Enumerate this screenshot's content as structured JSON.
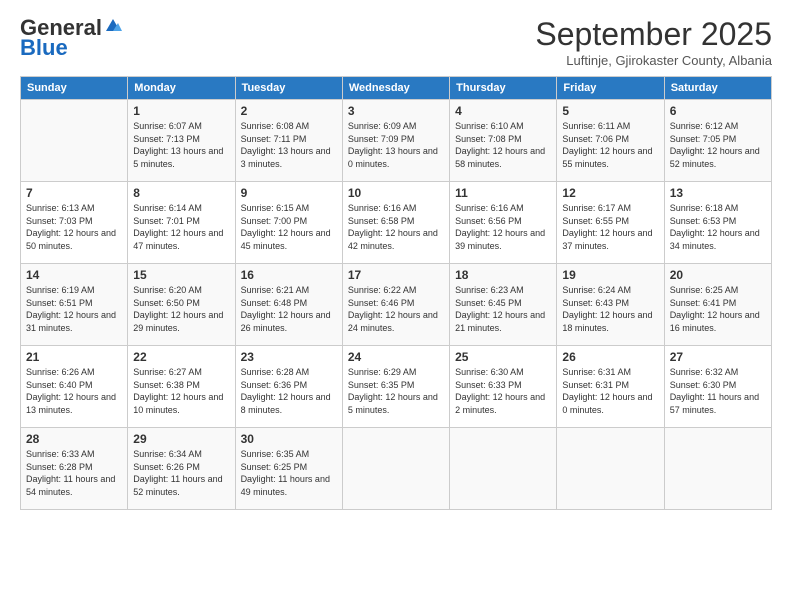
{
  "header": {
    "logo_line1": "General",
    "logo_line2": "Blue",
    "month_title": "September 2025",
    "location": "Luftinje, Gjirokaster County, Albania"
  },
  "days_of_week": [
    "Sunday",
    "Monday",
    "Tuesday",
    "Wednesday",
    "Thursday",
    "Friday",
    "Saturday"
  ],
  "weeks": [
    [
      {
        "day": "",
        "sunrise": "",
        "sunset": "",
        "daylight": ""
      },
      {
        "day": "1",
        "sunrise": "Sunrise: 6:07 AM",
        "sunset": "Sunset: 7:13 PM",
        "daylight": "Daylight: 13 hours and 5 minutes."
      },
      {
        "day": "2",
        "sunrise": "Sunrise: 6:08 AM",
        "sunset": "Sunset: 7:11 PM",
        "daylight": "Daylight: 13 hours and 3 minutes."
      },
      {
        "day": "3",
        "sunrise": "Sunrise: 6:09 AM",
        "sunset": "Sunset: 7:09 PM",
        "daylight": "Daylight: 13 hours and 0 minutes."
      },
      {
        "day": "4",
        "sunrise": "Sunrise: 6:10 AM",
        "sunset": "Sunset: 7:08 PM",
        "daylight": "Daylight: 12 hours and 58 minutes."
      },
      {
        "day": "5",
        "sunrise": "Sunrise: 6:11 AM",
        "sunset": "Sunset: 7:06 PM",
        "daylight": "Daylight: 12 hours and 55 minutes."
      },
      {
        "day": "6",
        "sunrise": "Sunrise: 6:12 AM",
        "sunset": "Sunset: 7:05 PM",
        "daylight": "Daylight: 12 hours and 52 minutes."
      }
    ],
    [
      {
        "day": "7",
        "sunrise": "Sunrise: 6:13 AM",
        "sunset": "Sunset: 7:03 PM",
        "daylight": "Daylight: 12 hours and 50 minutes."
      },
      {
        "day": "8",
        "sunrise": "Sunrise: 6:14 AM",
        "sunset": "Sunset: 7:01 PM",
        "daylight": "Daylight: 12 hours and 47 minutes."
      },
      {
        "day": "9",
        "sunrise": "Sunrise: 6:15 AM",
        "sunset": "Sunset: 7:00 PM",
        "daylight": "Daylight: 12 hours and 45 minutes."
      },
      {
        "day": "10",
        "sunrise": "Sunrise: 6:16 AM",
        "sunset": "Sunset: 6:58 PM",
        "daylight": "Daylight: 12 hours and 42 minutes."
      },
      {
        "day": "11",
        "sunrise": "Sunrise: 6:16 AM",
        "sunset": "Sunset: 6:56 PM",
        "daylight": "Daylight: 12 hours and 39 minutes."
      },
      {
        "day": "12",
        "sunrise": "Sunrise: 6:17 AM",
        "sunset": "Sunset: 6:55 PM",
        "daylight": "Daylight: 12 hours and 37 minutes."
      },
      {
        "day": "13",
        "sunrise": "Sunrise: 6:18 AM",
        "sunset": "Sunset: 6:53 PM",
        "daylight": "Daylight: 12 hours and 34 minutes."
      }
    ],
    [
      {
        "day": "14",
        "sunrise": "Sunrise: 6:19 AM",
        "sunset": "Sunset: 6:51 PM",
        "daylight": "Daylight: 12 hours and 31 minutes."
      },
      {
        "day": "15",
        "sunrise": "Sunrise: 6:20 AM",
        "sunset": "Sunset: 6:50 PM",
        "daylight": "Daylight: 12 hours and 29 minutes."
      },
      {
        "day": "16",
        "sunrise": "Sunrise: 6:21 AM",
        "sunset": "Sunset: 6:48 PM",
        "daylight": "Daylight: 12 hours and 26 minutes."
      },
      {
        "day": "17",
        "sunrise": "Sunrise: 6:22 AM",
        "sunset": "Sunset: 6:46 PM",
        "daylight": "Daylight: 12 hours and 24 minutes."
      },
      {
        "day": "18",
        "sunrise": "Sunrise: 6:23 AM",
        "sunset": "Sunset: 6:45 PM",
        "daylight": "Daylight: 12 hours and 21 minutes."
      },
      {
        "day": "19",
        "sunrise": "Sunrise: 6:24 AM",
        "sunset": "Sunset: 6:43 PM",
        "daylight": "Daylight: 12 hours and 18 minutes."
      },
      {
        "day": "20",
        "sunrise": "Sunrise: 6:25 AM",
        "sunset": "Sunset: 6:41 PM",
        "daylight": "Daylight: 12 hours and 16 minutes."
      }
    ],
    [
      {
        "day": "21",
        "sunrise": "Sunrise: 6:26 AM",
        "sunset": "Sunset: 6:40 PM",
        "daylight": "Daylight: 12 hours and 13 minutes."
      },
      {
        "day": "22",
        "sunrise": "Sunrise: 6:27 AM",
        "sunset": "Sunset: 6:38 PM",
        "daylight": "Daylight: 12 hours and 10 minutes."
      },
      {
        "day": "23",
        "sunrise": "Sunrise: 6:28 AM",
        "sunset": "Sunset: 6:36 PM",
        "daylight": "Daylight: 12 hours and 8 minutes."
      },
      {
        "day": "24",
        "sunrise": "Sunrise: 6:29 AM",
        "sunset": "Sunset: 6:35 PM",
        "daylight": "Daylight: 12 hours and 5 minutes."
      },
      {
        "day": "25",
        "sunrise": "Sunrise: 6:30 AM",
        "sunset": "Sunset: 6:33 PM",
        "daylight": "Daylight: 12 hours and 2 minutes."
      },
      {
        "day": "26",
        "sunrise": "Sunrise: 6:31 AM",
        "sunset": "Sunset: 6:31 PM",
        "daylight": "Daylight: 12 hours and 0 minutes."
      },
      {
        "day": "27",
        "sunrise": "Sunrise: 6:32 AM",
        "sunset": "Sunset: 6:30 PM",
        "daylight": "Daylight: 11 hours and 57 minutes."
      }
    ],
    [
      {
        "day": "28",
        "sunrise": "Sunrise: 6:33 AM",
        "sunset": "Sunset: 6:28 PM",
        "daylight": "Daylight: 11 hours and 54 minutes."
      },
      {
        "day": "29",
        "sunrise": "Sunrise: 6:34 AM",
        "sunset": "Sunset: 6:26 PM",
        "daylight": "Daylight: 11 hours and 52 minutes."
      },
      {
        "day": "30",
        "sunrise": "Sunrise: 6:35 AM",
        "sunset": "Sunset: 6:25 PM",
        "daylight": "Daylight: 11 hours and 49 minutes."
      },
      {
        "day": "",
        "sunrise": "",
        "sunset": "",
        "daylight": ""
      },
      {
        "day": "",
        "sunrise": "",
        "sunset": "",
        "daylight": ""
      },
      {
        "day": "",
        "sunrise": "",
        "sunset": "",
        "daylight": ""
      },
      {
        "day": "",
        "sunrise": "",
        "sunset": "",
        "daylight": ""
      }
    ]
  ]
}
